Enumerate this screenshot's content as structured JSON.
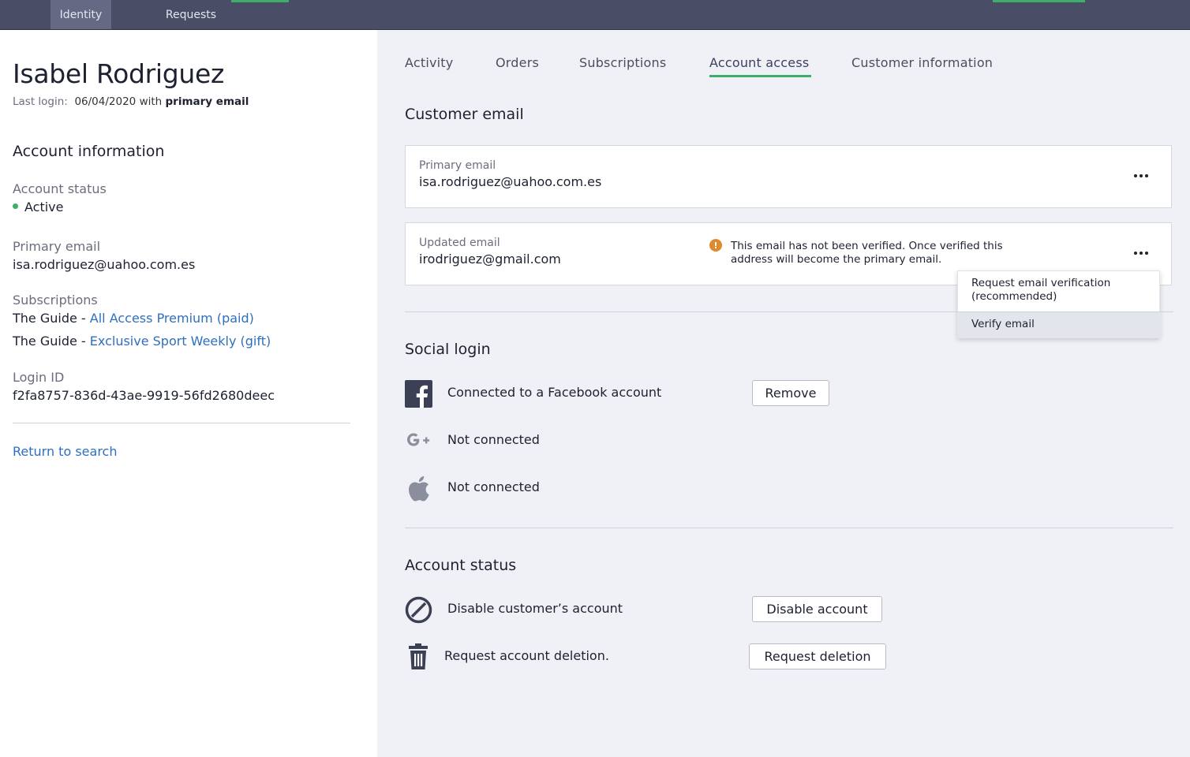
{
  "topnav": {
    "tabs": [
      {
        "label": "Identity",
        "active": true
      },
      {
        "label": "Requests",
        "active": false
      }
    ],
    "accent_color": "#3fae6b"
  },
  "customer": {
    "name": "Isabel Rodriguez",
    "last_login_label": "Last login:",
    "last_login_date": "06/04/2020",
    "last_login_with": "with",
    "last_login_method": "primary email"
  },
  "account_info": {
    "heading": "Account information",
    "status_label": "Account status",
    "status_value": "Active",
    "status_color": "#3fae6b",
    "primary_email_label": "Primary email",
    "primary_email_value": "isa.rodriguez@uahoo.com.es",
    "subscriptions_label": "Subscriptions",
    "subscriptions": [
      {
        "publication": "The Guide",
        "separator": " - ",
        "plan": "All Access Premium (paid)"
      },
      {
        "publication": "The Guide",
        "separator": " - ",
        "plan": "Exclusive Sport Weekly (gift)"
      }
    ],
    "login_id_label": "Login ID",
    "login_id_value": "f2fa8757-836d-43ae-9919-56fd2680deec",
    "return_link": "Return to search"
  },
  "tabs": [
    {
      "label": "Activity",
      "active": false
    },
    {
      "label": "Orders",
      "active": false
    },
    {
      "label": "Subscriptions",
      "active": false
    },
    {
      "label": "Account access",
      "active": true
    },
    {
      "label": "Customer information",
      "active": false
    }
  ],
  "customer_email": {
    "heading": "Customer email",
    "primary": {
      "label": "Primary email",
      "value": "isa.rodriguez@uahoo.com.es"
    },
    "updated": {
      "label": "Updated email",
      "value": "irodriguez@gmail.com",
      "warning_icon": "!",
      "warning_line1": "This email has not been verified. Once verified this",
      "warning_line2": "address will become the primary email."
    },
    "menu": [
      {
        "line1": "Request email verification",
        "line2": "(recommended)"
      },
      {
        "line1": "Verify email",
        "highlighted": true
      }
    ]
  },
  "social_login": {
    "heading": "Social login",
    "rows": [
      {
        "icon": "facebook-icon",
        "text": "Connected to a Facebook account",
        "button": "Remove"
      },
      {
        "icon": "google-plus-icon",
        "text": "Not connected"
      },
      {
        "icon": "apple-icon",
        "text": "Not connected"
      }
    ]
  },
  "account_status": {
    "heading": "Account status",
    "rows": [
      {
        "icon": "disable-icon",
        "text": "Disable customer’s account",
        "button": "Disable account"
      },
      {
        "icon": "trash-icon",
        "text": "Request account deletion.",
        "button": "Request deletion"
      }
    ]
  }
}
